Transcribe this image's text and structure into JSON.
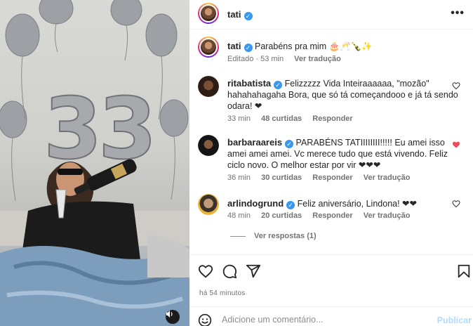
{
  "post": {
    "author": "tati",
    "verified_icon": "✓"
  },
  "header": {
    "more_label": "•••"
  },
  "caption": {
    "username": "tati",
    "text": "Parabéns pra mim 🎂🥂🍾✨",
    "edited": "Editado · 53 min",
    "translate": "Ver tradução"
  },
  "comments": [
    {
      "username": "ritabatista",
      "verified": true,
      "text": "Felizzzzz Vida Inteiraaaaaa, \"mozão\" hahahahagaha Bora, que só tá começandooo e já tá sendo odara! ❤",
      "time": "33 min",
      "likes": "48 curtidas",
      "reply": "Responder",
      "translate": "",
      "liked": false
    },
    {
      "username": "barbaraareis",
      "verified": true,
      "text": "PARABÉNS TATIIIIIIII!!!!! Eu amei isso amei amei amei. Vc merece tudo que está vivendo. Feliz ciclo novo. O melhor estar por vir ❤❤❤",
      "time": "36 min",
      "likes": "30 curtidas",
      "reply": "Responder",
      "translate": "Ver tradução",
      "liked": true
    },
    {
      "username": "arlindogrund",
      "verified": true,
      "text": "Feliz aniversário, Lindona! ❤❤",
      "time": "48 min",
      "likes": "20 curtidas",
      "reply": "Responder",
      "translate": "Ver tradução",
      "liked": false
    }
  ],
  "view_replies": "Ver respostas (1)",
  "footer": {
    "time_ago": "há 54 minutos",
    "comment_placeholder": "Adicione um comentário...",
    "post_label": "Publicar"
  },
  "icons": {
    "like": "heart-icon",
    "comment": "comment-icon",
    "share": "share-icon",
    "save": "bookmark-icon",
    "emoji": "emoji-icon",
    "audio": "speaker-icon"
  },
  "colors": {
    "accent_blue": "#3897f0",
    "like_red": "#ed4956",
    "muted_text": "#737373"
  }
}
